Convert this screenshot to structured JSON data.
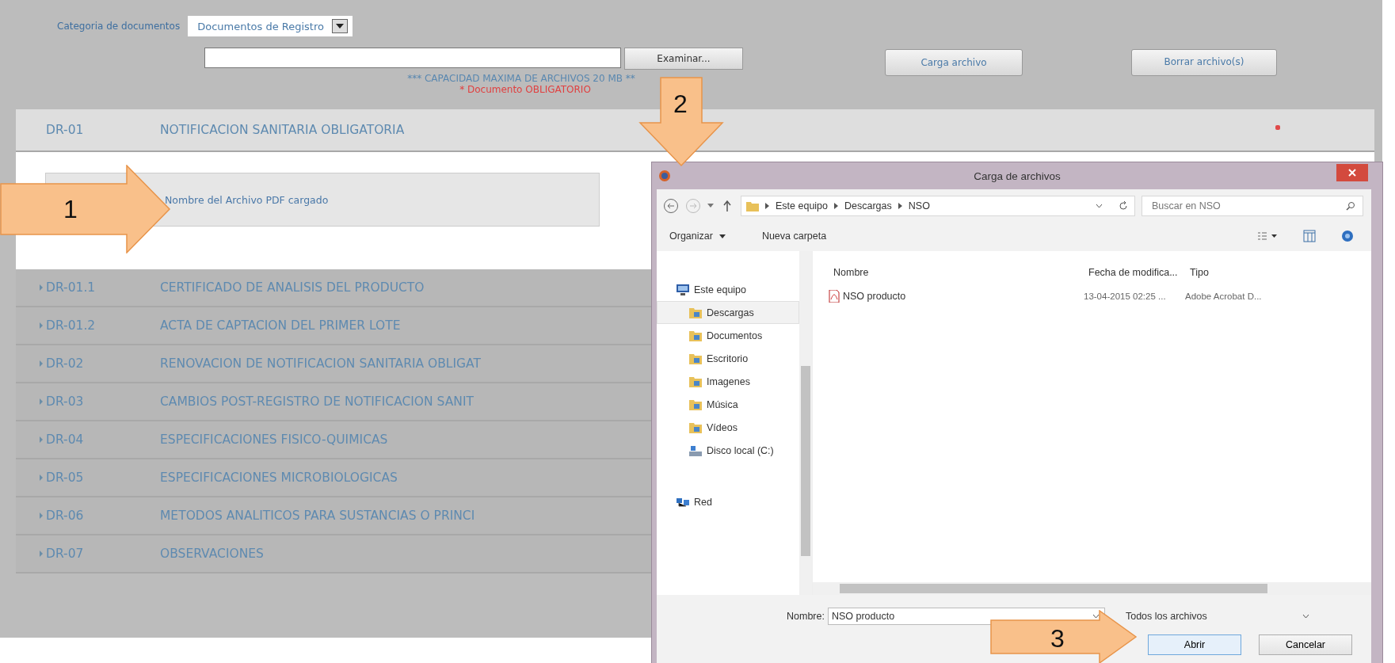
{
  "category": {
    "label": "Categoria de documentos",
    "value": "Documentos de Registro"
  },
  "upload": {
    "browse": "Examinar...",
    "note": "*** CAPACIDAD MAXIMA DE ARCHIVOS 20 MB **",
    "required": "* Documento OBLIGATORIO"
  },
  "actions": [
    "Carga archivo",
    "Borrar archivo(s)"
  ],
  "sections": [
    {
      "code": "DR-01",
      "title": "NOTIFICACION SANITARIA OBLIGATORIA",
      "expanded": true,
      "file": "Nombre del Archivo PDF cargado"
    },
    {
      "code": "DR-01.1",
      "title": "CERTIFICADO DE ANALISIS DEL PRODUCTO",
      "expanded": false
    },
    {
      "code": "DR-01.2",
      "title": "ACTA DE CAPTACION DEL PRIMER LOTE",
      "expanded": false
    },
    {
      "code": "DR-02",
      "title": "RENOVACION DE NOTIFICACION SANITARIA OBLIGAT",
      "expanded": false
    },
    {
      "code": "DR-03",
      "title": "CAMBIOS POST-REGISTRO DE NOTIFICACION SANIT",
      "expanded": false
    },
    {
      "code": "DR-04",
      "title": "ESPECIFICACIONES FISICO-QUIMICAS",
      "expanded": false
    },
    {
      "code": "DR-05",
      "title": "ESPECIFICACIONES MICROBIOLOGICAS",
      "expanded": false
    },
    {
      "code": "DR-06",
      "title": "METODOS ANALITICOS PARA SUSTANCIAS O PRINCI",
      "expanded": false
    },
    {
      "code": "DR-07",
      "title": "OBSERVACIONES",
      "expanded": false
    }
  ],
  "dialog": {
    "title": "Carga de archivos",
    "path": [
      "Este equipo",
      "Descargas",
      "NSO"
    ],
    "search": {
      "placeholder": "Buscar en NSO"
    },
    "toolbar": [
      "Organizar",
      "Nueva carpeta"
    ],
    "nav": [
      {
        "label": "Este equipo",
        "kind": "computer",
        "selected": false,
        "children": [
          {
            "label": "Descargas",
            "kind": "folder",
            "selected": true
          },
          {
            "label": "Documentos",
            "kind": "folder",
            "selected": false
          },
          {
            "label": "Escritorio",
            "kind": "folder",
            "selected": false
          },
          {
            "label": "Imagenes",
            "kind": "folder",
            "selected": false
          },
          {
            "label": "Música",
            "kind": "folder",
            "selected": false
          },
          {
            "label": "Vídeos",
            "kind": "folder",
            "selected": false
          },
          {
            "label": "Disco local (C:)",
            "kind": "drive",
            "selected": false
          }
        ]
      },
      {
        "label": "Red",
        "kind": "network",
        "selected": false
      }
    ],
    "columns": [
      "Nombre",
      "Fecha de modifica...",
      "Tipo"
    ],
    "files": [
      {
        "name": "NSO producto",
        "date": "13-04-2015 02:25 ...",
        "type": "Adobe Acrobat D..."
      }
    ],
    "filename_label": "Nombre:",
    "filename": "NSO producto",
    "filter": "Todos los archivos",
    "buttons": [
      "Abrir",
      "Cancelar"
    ]
  },
  "callouts": [
    "1",
    "2",
    "3"
  ]
}
